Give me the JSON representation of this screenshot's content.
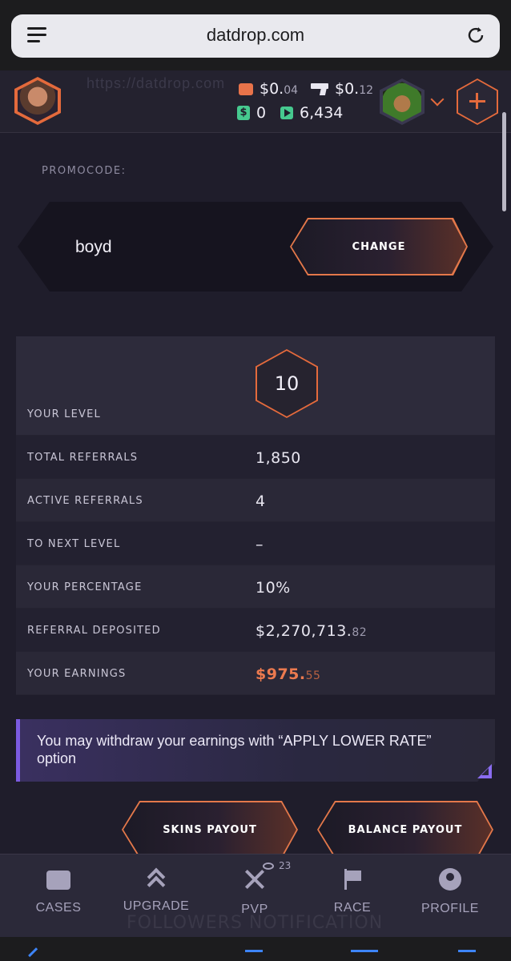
{
  "browser": {
    "domain": "datdrop.com"
  },
  "header": {
    "ghost_url": "https://datdrop.com",
    "balance_main": "$0.",
    "balance_main_cents": "04",
    "balance_gun": "$0.",
    "balance_gun_cents": "12",
    "cash_count": "0",
    "play_count": "6,434",
    "accent_color": "#e46a3c"
  },
  "promo": {
    "label": "PROMOCODE:",
    "value": "boyd",
    "change_label": "CHANGE"
  },
  "stats": {
    "level_label": "YOUR LEVEL",
    "level_value": "10",
    "rows": [
      {
        "label": "TOTAL REFERRALS",
        "value": "1,850",
        "cents": ""
      },
      {
        "label": "ACTIVE REFERRALS",
        "value": "4",
        "cents": ""
      },
      {
        "label": "TO NEXT LEVEL",
        "value": "–",
        "cents": ""
      },
      {
        "label": "YOUR PERCENTAGE",
        "value": "10%",
        "cents": ""
      },
      {
        "label": "REFERRAL DEPOSITED",
        "value": "$2,270,713.",
        "cents": "82"
      },
      {
        "label": "YOUR EARNINGS",
        "value": "$975.",
        "cents": "55"
      }
    ]
  },
  "notice": {
    "text": "You may withdraw your earnings with “APPLY LOWER RATE” option"
  },
  "payout": {
    "skins_label": "SKINS PAYOUT",
    "balance_label": "BALANCE PAYOUT"
  },
  "nav": {
    "viewers": "23",
    "items": [
      {
        "label": "CASES",
        "icon": "cases-icon"
      },
      {
        "label": "UPGRADE",
        "icon": "upgrade-icon"
      },
      {
        "label": "PVP",
        "icon": "pvp-icon"
      },
      {
        "label": "RACE",
        "icon": "race-icon"
      },
      {
        "label": "PROFILE",
        "icon": "profile-icon"
      }
    ]
  },
  "footer_ghost": "FOLLOWERS NOTIFICATION"
}
